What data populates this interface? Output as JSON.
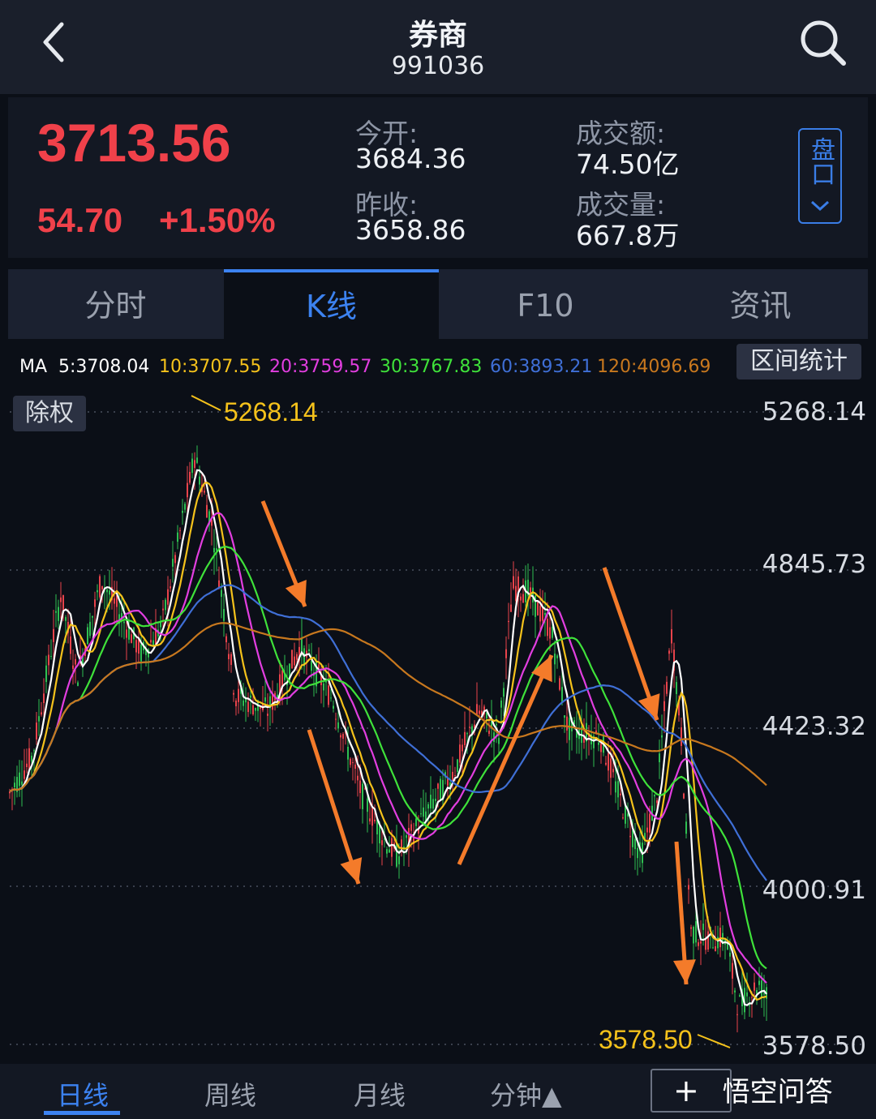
{
  "header": {
    "title": "券商",
    "code": "991036"
  },
  "quote": {
    "price": "3713.56",
    "change": "54.70",
    "change_pct": "+1.50%",
    "open_label": "今开:",
    "open_value": "3684.36",
    "prev_close_label": "昨收:",
    "prev_close_value": "3658.86",
    "amount_label": "成交额:",
    "amount_value": "74.50亿",
    "volume_label": "成交量:",
    "volume_value": "667.8万",
    "pankou": "盘口"
  },
  "tabs": [
    "分时",
    "K线",
    "F10",
    "资讯"
  ],
  "active_tab": "K线",
  "ma_legend": {
    "prefix": "MA",
    "items": [
      {
        "text": "5:3708.04",
        "color": "#ffffff"
      },
      {
        "text": "10:3707.55",
        "color": "#f5c21b"
      },
      {
        "text": "20:3759.57",
        "color": "#e23ee0"
      },
      {
        "text": "30:3767.83",
        "color": "#3fe23a"
      },
      {
        "text": "60:3893.21",
        "color": "#3f6fd6"
      },
      {
        "text": "120:4096.69",
        "color": "#c8781e"
      }
    ]
  },
  "range_stats_button": "区间统计",
  "adjust_button": "除权",
  "chart_data": {
    "type": "line",
    "title": "",
    "y_axis_ticks": [
      "5268.14",
      "4845.73",
      "4423.32",
      "4000.91",
      "3578.50"
    ],
    "ylim": [
      3578.5,
      5268.14
    ],
    "high_label": "5268.14",
    "low_label": "3578.50",
    "series": [
      {
        "name": "5",
        "color": "#ffffff"
      },
      {
        "name": "10",
        "color": "#f5c21b"
      },
      {
        "name": "20",
        "color": "#e23ee0"
      },
      {
        "name": "30",
        "color": "#3fe23a"
      },
      {
        "name": "60",
        "color": "#3f6fd6"
      },
      {
        "name": "120",
        "color": "#c8781e"
      }
    ],
    "annotation_arrow_color": "#f47b2a"
  },
  "bottom_tabs": [
    "日线",
    "周线",
    "月线",
    "分钟▲"
  ],
  "active_bottom_tab": "日线",
  "watermark": "悟空问答"
}
